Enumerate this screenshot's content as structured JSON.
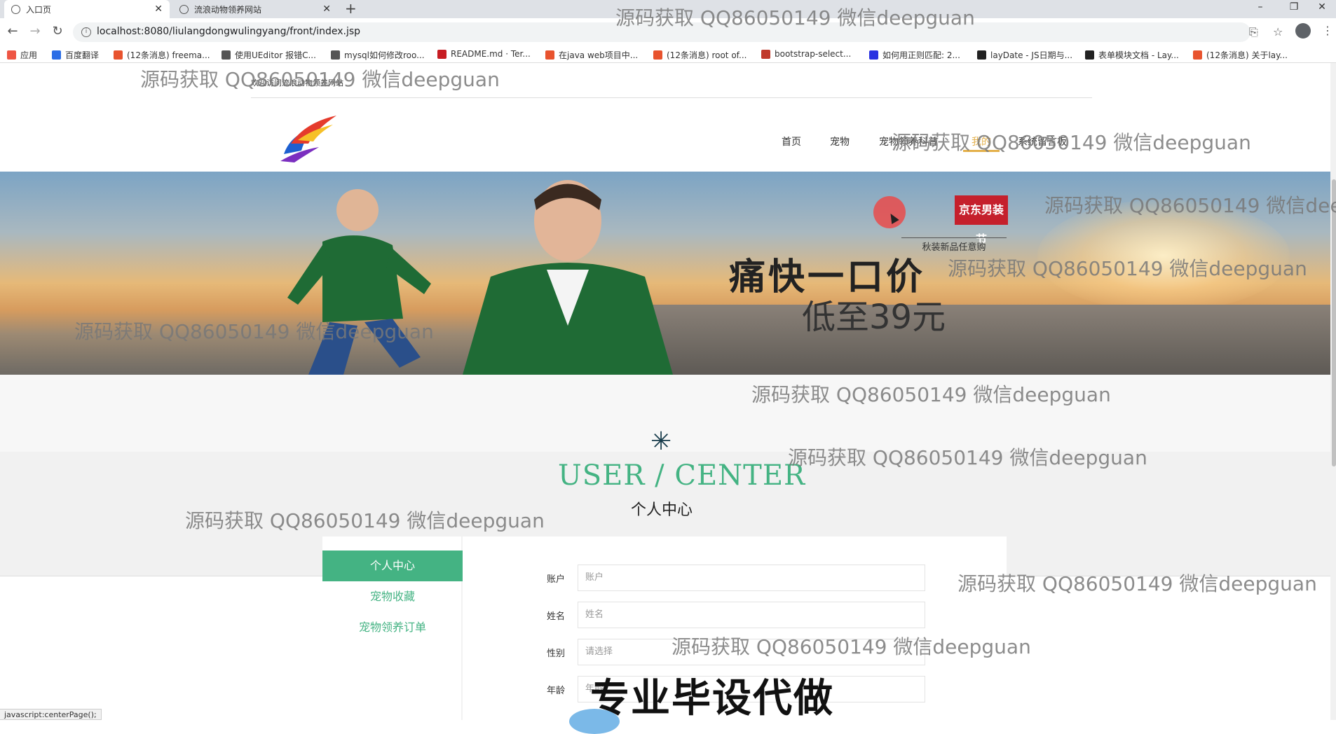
{
  "browser": {
    "tabs": [
      {
        "label": "入口页",
        "active": true
      },
      {
        "label": "流浪动物领养网站",
        "active": false
      }
    ],
    "new_tab_symbol": "+",
    "window_controls": {
      "minimize": "–",
      "restore": "❐",
      "close": "✕"
    },
    "url": "localhost:8080/liulangdongwulingyang/front/index.jsp",
    "bookmarks": [
      {
        "label": "应用",
        "icon": "apps-icon",
        "color": "#e54"
      },
      {
        "label": "百度翻译",
        "icon": "baidu-translate-icon",
        "color": "#2b6de6"
      },
      {
        "label": "(12条消息) freema...",
        "icon": "csdn-icon",
        "color": "#e8532e"
      },
      {
        "label": "使用UEditor 报错C...",
        "icon": "link-icon",
        "color": "#555"
      },
      {
        "label": "mysql如何修改roo...",
        "icon": "link-icon",
        "color": "#555"
      },
      {
        "label": "README.md · Ter...",
        "icon": "gitee-icon",
        "color": "#c71d23"
      },
      {
        "label": "在java web项目中...",
        "icon": "csdn-icon",
        "color": "#e8532e"
      },
      {
        "label": "(12条消息) root of...",
        "icon": "csdn-icon",
        "color": "#e8532e"
      },
      {
        "label": "bootstrap-select...",
        "icon": "doc-icon",
        "color": "#c0392b"
      },
      {
        "label": "如何用正则匹配: 2...",
        "icon": "baidu-icon",
        "color": "#2932e1"
      },
      {
        "label": "layDate - JS日期与...",
        "icon": "layui-icon",
        "color": "#222"
      },
      {
        "label": "表单模块文档 - Lay...",
        "icon": "layui-icon",
        "color": "#222"
      },
      {
        "label": "(12条消息) 关于lay...",
        "icon": "csdn-icon",
        "color": "#e8532e"
      }
    ]
  },
  "site": {
    "top_text": "欢迎访问流浪动物领养网站",
    "nav": [
      {
        "label": "首页",
        "active": false
      },
      {
        "label": "宠物",
        "active": false
      },
      {
        "label": "宠物领养科普",
        "active": false
      },
      {
        "label": "我的",
        "active": true
      },
      {
        "label": "系统留言板",
        "active": false
      }
    ],
    "banner": {
      "brand": "京东男装节",
      "brand_sub": "秋装新品任意购",
      "headline": "痛快一口价",
      "subline": "低至39元"
    },
    "section_title_en": "USER / CENTER",
    "section_title_cn": "个人中心",
    "sidebar": [
      {
        "label": "个人中心",
        "active": true
      },
      {
        "label": "宠物收藏",
        "active": false
      },
      {
        "label": "宠物领养订单",
        "active": false
      }
    ],
    "form": [
      {
        "label": "账户",
        "placeholder": "账户"
      },
      {
        "label": "姓名",
        "placeholder": "姓名"
      },
      {
        "label": "性别",
        "placeholder": "请选择"
      },
      {
        "label": "年龄",
        "placeholder": "年龄"
      }
    ]
  },
  "status_bar": "javascript:centerPage();",
  "watermarks": [
    "源码获取 QQ86050149 微信deepguan"
  ],
  "overlay_text": "专业毕设代做",
  "colors": {
    "accent_green": "#44b383",
    "nav_active": "#e4b04a",
    "brand_red": "#c5202c"
  }
}
